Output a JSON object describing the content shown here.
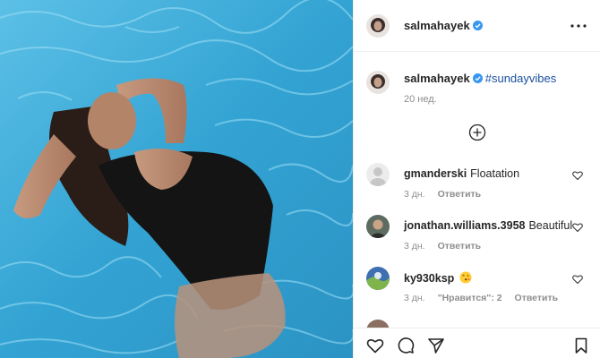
{
  "header": {
    "username": "salmahayek",
    "verified": true
  },
  "caption": {
    "username": "salmahayek",
    "hashtag": "#sundayvibes",
    "time": "20 нед."
  },
  "comments": [
    {
      "username": "gmanderski",
      "text": "Floatation",
      "time": "3 дн.",
      "reply": "Ответить",
      "avatar": "default-avatar"
    },
    {
      "username": "jonathan.williams.3958",
      "text": "Beautiful",
      "time": "3 дн.",
      "reply": "Ответить",
      "avatar": "photo-avatar"
    },
    {
      "username": "ky930ksp",
      "text": "",
      "emoji": "kissing-face-emoji",
      "time": "3 дн.",
      "likes": "\"Нравится\": 2",
      "reply": "Ответить",
      "avatar": "photo-avatar"
    }
  ],
  "icons": {
    "more": "more-options-icon",
    "load_more": "plus-circle-icon",
    "like": "heart-icon",
    "comment": "comment-icon",
    "share": "paper-plane-icon",
    "save": "bookmark-icon"
  },
  "colors": {
    "verified_badge": "#3897f0",
    "hashtag": "#1b4fa0",
    "muted_text": "#8e8e8e",
    "pool_water": "#3aa9d6"
  }
}
